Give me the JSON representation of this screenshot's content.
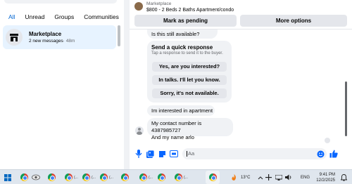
{
  "filters": {
    "tabs": [
      {
        "label": "All",
        "active": true
      },
      {
        "label": "Unread",
        "active": false
      },
      {
        "label": "Groups",
        "active": false
      },
      {
        "label": "Communities",
        "active": false
      }
    ]
  },
  "conversation": {
    "name": "Marketplace",
    "preview": "2 new messages",
    "time": "· 48m",
    "icon": "storefront-icon"
  },
  "header": {
    "title": "Marketplace",
    "subtitle": "$800 - 2 Beds 2 Baths Apartment/condo",
    "mark_pending": "Mark as pending",
    "more_options": "More options"
  },
  "messages": {
    "availability": "Is this still available?",
    "quick_response": {
      "title": "Send a quick response",
      "subtitle": "Tap a response to send it to the buyer.",
      "options": [
        "Yes, are you interested?",
        "In talks. I'll let you know.",
        "Sorry, it's not available."
      ]
    },
    "interest": "Im interested in apartment",
    "contact_line1": "My contact number is 4387985727",
    "contact_line2": "And my name arlo"
  },
  "composer": {
    "placeholder": "Aa",
    "icons": [
      "microphone-icon",
      "photo-icon",
      "sticker-icon",
      "gif-icon",
      "emoji-icon",
      "thumbs-up-icon"
    ],
    "accent": "#0866ff"
  },
  "taskbar": {
    "labels": [
      "(...",
      "(...",
      "(...",
      "(...",
      "(..."
    ],
    "temperature": "13°C",
    "language": "ENG",
    "time": "9:41 PM",
    "date": "12/2/2025"
  },
  "colors": {
    "accent": "#0866ff",
    "selected_bg": "#e7f3ff",
    "bubble_bg": "#f0f2f5"
  }
}
